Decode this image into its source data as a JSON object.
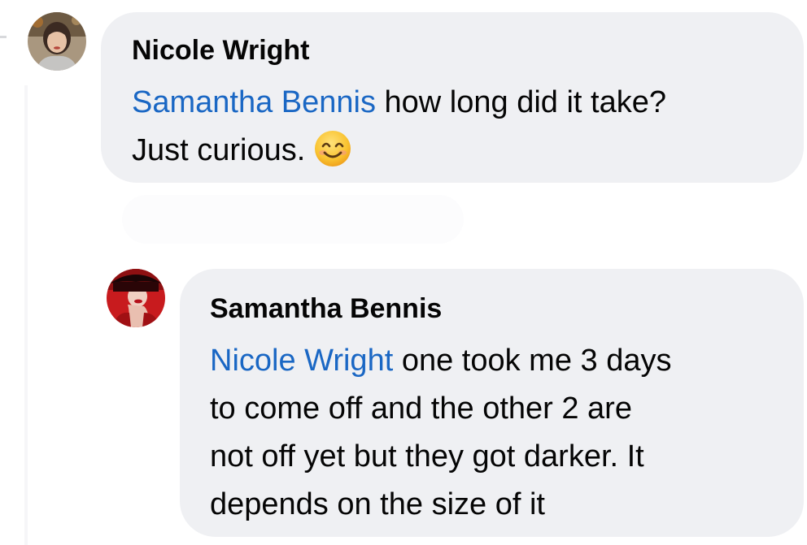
{
  "comments": [
    {
      "author": "Nicole Wright",
      "mention": "Samantha Bennis",
      "text_line1": " how long did it take?",
      "text_line2": "Just curious.",
      "emoji": "smiling-face-icon",
      "avatar": "nicole-avatar"
    },
    {
      "author": "Samantha Bennis",
      "mention": "Nicole Wright",
      "text_line1": " one took me 3 days",
      "text_line2": "to come off and the other 2 are",
      "text_line3": "not off yet but they got darker. It",
      "text_line4": "depends on the size of it",
      "avatar": "samantha-avatar"
    }
  ],
  "colors": {
    "bubble": "#eff0f3",
    "mention": "#1a67c4",
    "text": "#050505"
  }
}
